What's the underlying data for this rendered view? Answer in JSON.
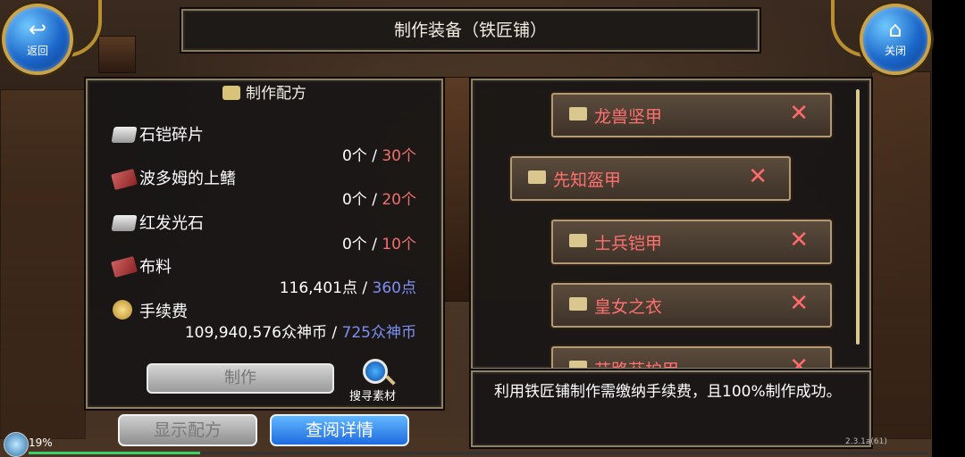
{
  "header": {
    "title": "制作装备（铁匠铺）"
  },
  "nav": {
    "back_label": "返回",
    "close_label": "关闭"
  },
  "recipe": {
    "title": "制作配方",
    "materials": [
      {
        "name": "石铠碎片",
        "have": "0个",
        "sep": " / ",
        "need": "30个",
        "icon": "stone-icon"
      },
      {
        "name": "波多姆的上鳍",
        "have": "0个",
        "sep": " / ",
        "need": "20个",
        "icon": "cloth-icon"
      },
      {
        "name": "红发光石",
        "have": "0个",
        "sep": " / ",
        "need": "10个",
        "icon": "stone-icon"
      },
      {
        "name": "布料",
        "have": "116,401点",
        "sep": " / ",
        "need": "360点",
        "icon": "cloth-icon"
      }
    ],
    "fee": {
      "label": "手续费",
      "have": "109,940,576众神币",
      "sep": " / ",
      "need": "725众神币"
    },
    "make_button": "制作",
    "search_label": "搜寻素材"
  },
  "equipment": {
    "items": [
      {
        "name": "龙兽坚甲"
      },
      {
        "name": "先知盔甲"
      },
      {
        "name": "士兵铠甲"
      },
      {
        "name": "皇女之衣"
      },
      {
        "name": "艾路芬护甲"
      }
    ]
  },
  "description": {
    "text": "利用铁匠铺制作需缴纳手续费，且100%制作成功。"
  },
  "buttons": {
    "show_recipe": "显示配方",
    "view_details": "查阅详情"
  },
  "status": {
    "progress_text": "19%",
    "progress_value": 0.19,
    "version": "2.3.1a(61)"
  },
  "colors": {
    "required_red": "#f07070",
    "required_blue": "#7e8ff2",
    "item_name": "#ff7070",
    "accent_blue": "#1d6be0"
  }
}
